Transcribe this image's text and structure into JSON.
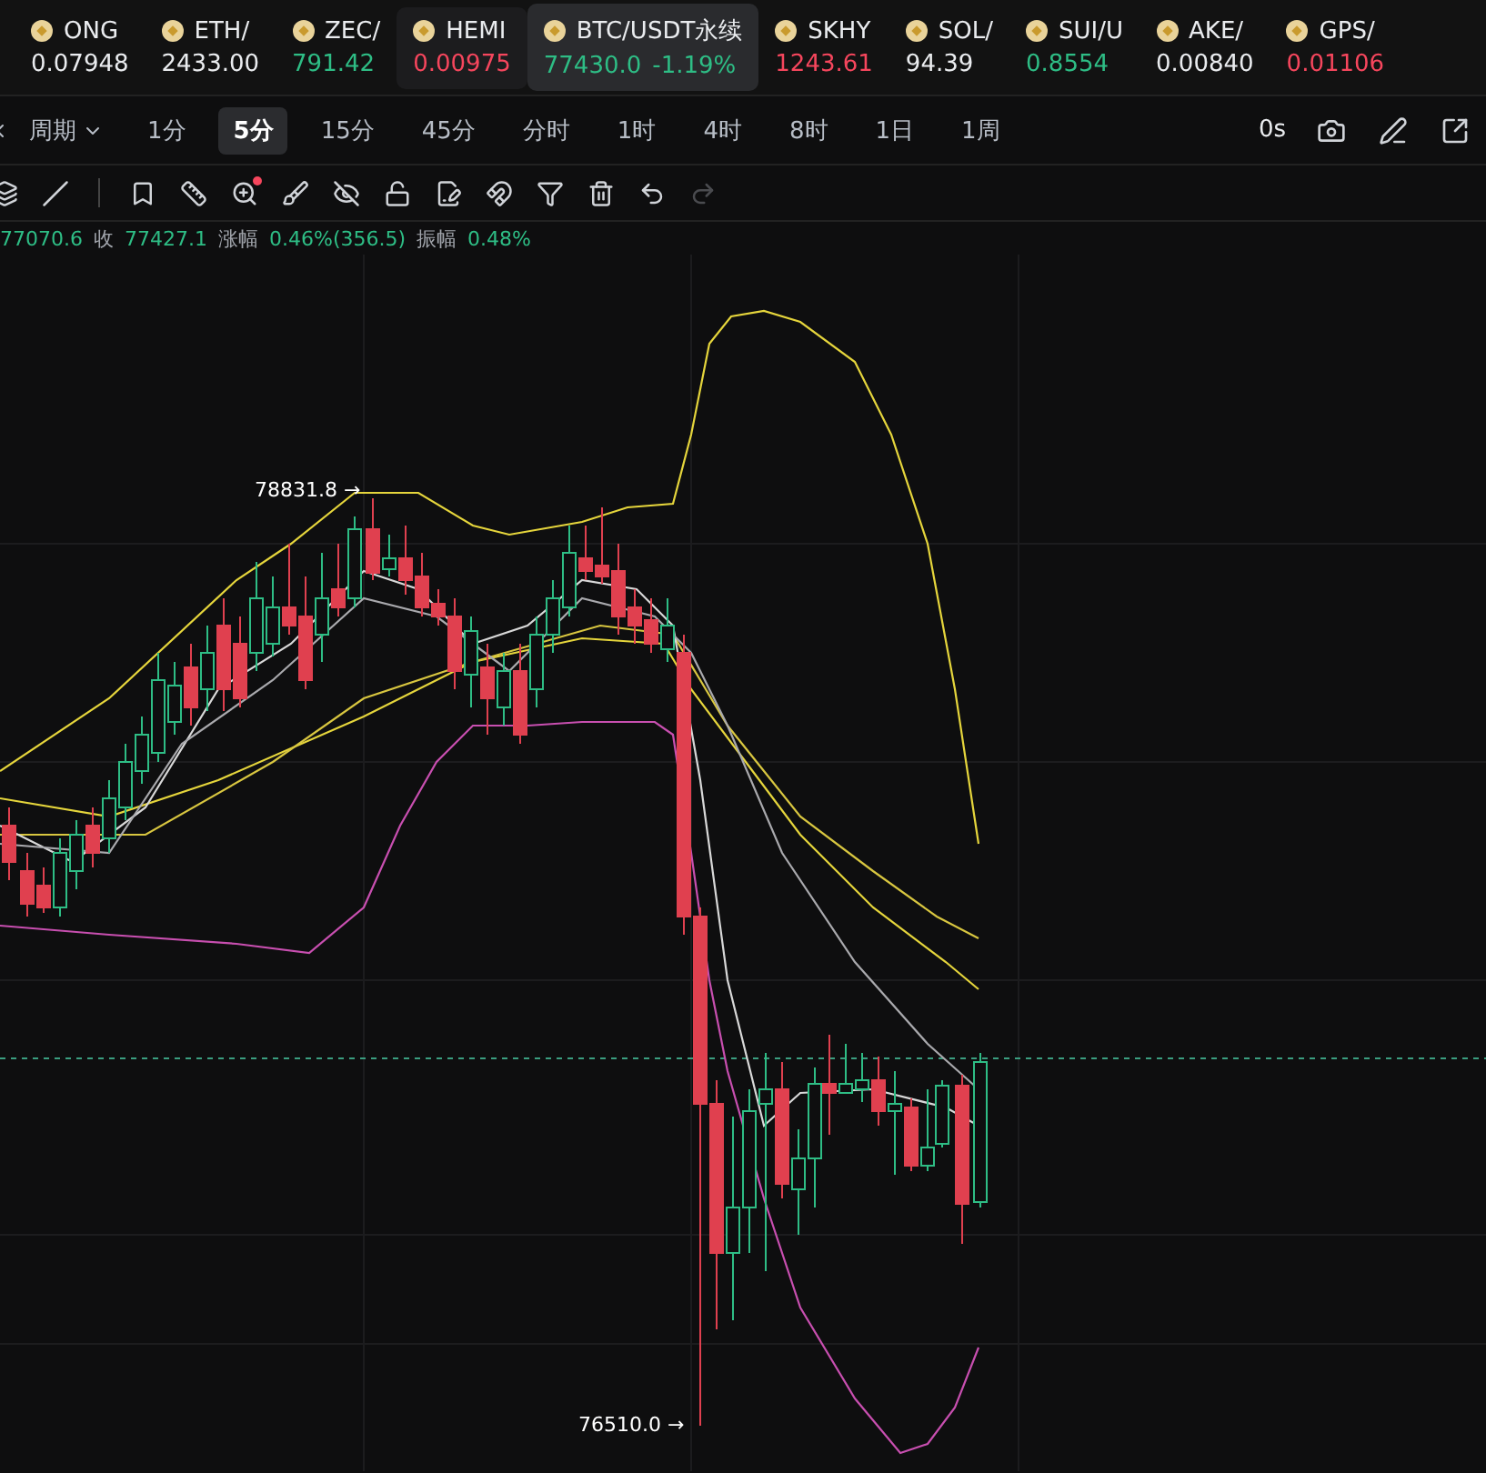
{
  "tickers": [
    {
      "symbol": "ONG",
      "price": "0.07948",
      "color": "#eaecef",
      "selected": false,
      "hovered": false
    },
    {
      "symbol": "ETH/",
      "price": "2433.00",
      "color": "#eaecef",
      "selected": false,
      "hovered": false
    },
    {
      "symbol": "ZEC/",
      "price": "791.42",
      "color": "#2ebd85",
      "selected": false,
      "hovered": false
    },
    {
      "symbol": "HEMI",
      "price": "0.00975",
      "color": "#f6465d",
      "selected": false,
      "hovered": true
    },
    {
      "symbol": "BTC/USDT永续",
      "price": "77430.0",
      "change": "-1.19%",
      "color": "#2ebd85",
      "selected": true,
      "hovered": false
    },
    {
      "symbol": "SKHY",
      "price": "1243.61",
      "color": "#f6465d",
      "selected": false,
      "hovered": false
    },
    {
      "symbol": "SOL/",
      "price": "94.39",
      "color": "#eaecef",
      "selected": false,
      "hovered": false
    },
    {
      "symbol": "SUI/U",
      "price": "0.8554",
      "color": "#2ebd85",
      "selected": false,
      "hovered": false
    },
    {
      "symbol": "AKE/",
      "price": "0.00840",
      "color": "#eaecef",
      "selected": false,
      "hovered": false
    },
    {
      "symbol": "GPS/",
      "price": "0.01106",
      "color": "#f6465d",
      "selected": false,
      "hovered": false
    }
  ],
  "period_bar": {
    "dropdown": "周期",
    "tabs": [
      {
        "label": "1分",
        "selected": false
      },
      {
        "label": "5分",
        "selected": true
      },
      {
        "label": "15分",
        "selected": false
      },
      {
        "label": "45分",
        "selected": false
      },
      {
        "label": "分时",
        "selected": false
      },
      {
        "label": "1时",
        "selected": false
      },
      {
        "label": "4时",
        "selected": false
      },
      {
        "label": "8时",
        "selected": false
      },
      {
        "label": "1日",
        "selected": false
      },
      {
        "label": "1周",
        "selected": false
      }
    ],
    "countdown": "0s"
  },
  "tools": [
    {
      "kind": "layers",
      "disabled": false,
      "alert": false
    },
    {
      "kind": "slash",
      "disabled": false,
      "alert": false
    },
    {
      "kind": "divider",
      "disabled": false,
      "alert": false
    },
    {
      "kind": "bookmark",
      "disabled": false,
      "alert": false
    },
    {
      "kind": "ruler",
      "disabled": false,
      "alert": false
    },
    {
      "kind": "zoom",
      "disabled": false,
      "alert": true
    },
    {
      "kind": "brush",
      "disabled": false,
      "alert": false
    },
    {
      "kind": "hide",
      "disabled": false,
      "alert": false
    },
    {
      "kind": "lock",
      "disabled": false,
      "alert": false
    },
    {
      "kind": "note",
      "disabled": false,
      "alert": false
    },
    {
      "kind": "magnet",
      "disabled": false,
      "alert": false
    },
    {
      "kind": "filter",
      "disabled": false,
      "alert": false
    },
    {
      "kind": "trash",
      "disabled": false,
      "alert": false
    },
    {
      "kind": "undo",
      "disabled": false,
      "alert": false
    },
    {
      "kind": "redo",
      "disabled": true,
      "alert": false
    }
  ],
  "ohlc": [
    {
      "value": "77070.6"
    },
    {
      "label": "收",
      "value": "77427.1"
    },
    {
      "label": "涨幅",
      "value": "0.46%(356.5)"
    },
    {
      "label": "振幅",
      "value": "0.48%"
    }
  ],
  "chart": {
    "high_label": "78831.8 →",
    "low_label": "76510.0 →"
  }
}
